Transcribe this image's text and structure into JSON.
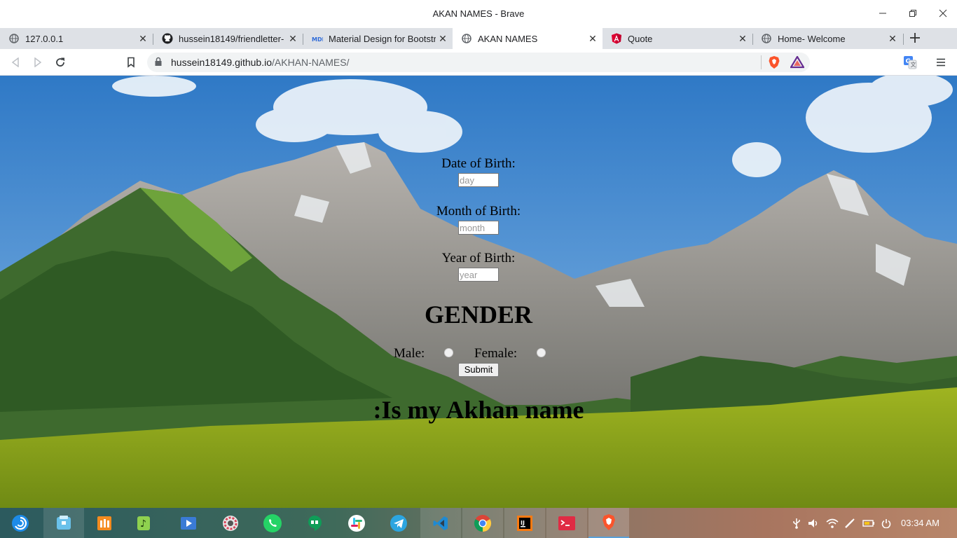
{
  "window": {
    "title": "AKAN NAMES - Brave"
  },
  "tabs": [
    {
      "label": "127.0.0.1",
      "icon": "globe-icon"
    },
    {
      "label": "hussein18149/friendletter-",
      "icon": "github-icon"
    },
    {
      "label": "Material Design for Bootstr",
      "icon": "mdb-icon"
    },
    {
      "label": "AKAN NAMES",
      "icon": "globe-icon",
      "active": true
    },
    {
      "label": "Quote",
      "icon": "angular-icon"
    },
    {
      "label": "Home- Welcome",
      "icon": "globe-icon"
    }
  ],
  "toolbar": {
    "url_host": "hussein18149.github.io",
    "url_path": "/AKHAN-NAMES/"
  },
  "page": {
    "day_label": "Date of Birth:",
    "day_placeholder": "day",
    "month_label": "Month of Birth:",
    "month_placeholder": "month",
    "year_label": "Year of Birth:",
    "year_placeholder": "year",
    "gender_title": "GENDER",
    "male_label": "Male:",
    "female_label": "Female:",
    "submit_label": "Submit",
    "result_text": ":Is my Akhan name"
  },
  "taskbar": {
    "apps": [
      "launcher-icon",
      "file-manager-icon",
      "app-store-icon",
      "music-icon",
      "video-icon",
      "settings-icon",
      "whatsapp-icon",
      "hangouts-icon",
      "slack-icon",
      "telegram-icon",
      "vscode-icon",
      "chrome-icon",
      "intellij-icon",
      "terminal-icon",
      "brave-icon"
    ],
    "clock": "03:34 AM"
  },
  "colors": {
    "accent": "#5aa0d8",
    "sky": "#3b7fc9",
    "grass": "#a9b81f"
  }
}
